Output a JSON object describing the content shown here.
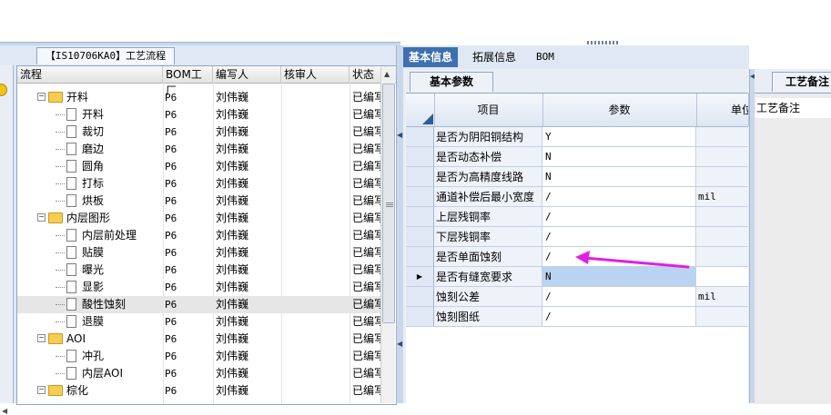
{
  "left_panel": {
    "process_tab": "【IS10706KA0】工艺流程",
    "columns": [
      "流程",
      "BOM工厂",
      "编写人",
      "核审人",
      "状态"
    ],
    "rows": [
      {
        "name": "开料",
        "type": "folder",
        "bom": "P6",
        "writer": "刘伟巍",
        "reviewer": "",
        "status": "已编写"
      },
      {
        "name": "开料",
        "type": "doc",
        "bom": "P6",
        "writer": "刘伟巍",
        "reviewer": "",
        "status": "已编写"
      },
      {
        "name": "裁切",
        "type": "doc",
        "bom": "P6",
        "writer": "刘伟巍",
        "reviewer": "",
        "status": "已编写"
      },
      {
        "name": "磨边",
        "type": "doc",
        "bom": "P6",
        "writer": "刘伟巍",
        "reviewer": "",
        "status": "已编写"
      },
      {
        "name": "圆角",
        "type": "doc",
        "bom": "P6",
        "writer": "刘伟巍",
        "reviewer": "",
        "status": "已编写"
      },
      {
        "name": "打标",
        "type": "doc",
        "bom": "P6",
        "writer": "刘伟巍",
        "reviewer": "",
        "status": "已编写"
      },
      {
        "name": "烘板",
        "type": "doc",
        "bom": "P6",
        "writer": "刘伟巍",
        "reviewer": "",
        "status": "已编写"
      },
      {
        "name": "内层图形",
        "type": "folder",
        "bom": "P6",
        "writer": "刘伟巍",
        "reviewer": "",
        "status": "已编写"
      },
      {
        "name": "内层前处理",
        "type": "doc",
        "bom": "P6",
        "writer": "刘伟巍",
        "reviewer": "",
        "status": "已编写"
      },
      {
        "name": "贴膜",
        "type": "doc",
        "bom": "P6",
        "writer": "刘伟巍",
        "reviewer": "",
        "status": "已编写"
      },
      {
        "name": "曝光",
        "type": "doc",
        "bom": "P6",
        "writer": "刘伟巍",
        "reviewer": "",
        "status": "已编写"
      },
      {
        "name": "显影",
        "type": "doc",
        "bom": "P6",
        "writer": "刘伟巍",
        "reviewer": "",
        "status": "已编写"
      },
      {
        "name": "酸性蚀刻",
        "type": "doc",
        "bom": "P6",
        "writer": "刘伟巍",
        "reviewer": "",
        "status": "已编写",
        "selected": true
      },
      {
        "name": "退膜",
        "type": "doc",
        "bom": "P6",
        "writer": "刘伟巍",
        "reviewer": "",
        "status": "已编写"
      },
      {
        "name": "AOI",
        "type": "folder",
        "bom": "P6",
        "writer": "刘伟巍",
        "reviewer": "",
        "status": "已编写"
      },
      {
        "name": "冲孔",
        "type": "doc",
        "bom": "P6",
        "writer": "刘伟巍",
        "reviewer": "",
        "status": "已编写"
      },
      {
        "name": "内层AOI",
        "type": "doc",
        "bom": "P6",
        "writer": "刘伟巍",
        "reviewer": "",
        "status": "已编写"
      },
      {
        "name": "棕化",
        "type": "folder",
        "bom": "P6",
        "writer": "刘伟巍",
        "reviewer": "",
        "status": "已编写"
      }
    ]
  },
  "middle_panel": {
    "tabs": [
      "基本信息",
      "拓展信息",
      "BOM"
    ],
    "active_tab": "基本信息",
    "subtab": "基本参数",
    "columns": {
      "item": "项目",
      "param": "参数",
      "unit": "单位"
    },
    "rows": [
      {
        "item": "是否为阴阳铜结构",
        "value": "Y",
        "unit": ""
      },
      {
        "item": "是否动态补偿",
        "value": "N",
        "unit": ""
      },
      {
        "item": "是否为高精度线路",
        "value": "N",
        "unit": ""
      },
      {
        "item": "通道补偿后最小宽度",
        "value": "/",
        "unit": "mil"
      },
      {
        "item": "上层残铜率",
        "value": "/",
        "unit": ""
      },
      {
        "item": "下层残铜率",
        "value": "/",
        "unit": ""
      },
      {
        "item": "是否单面蚀刻",
        "value": "/",
        "unit": ""
      },
      {
        "item": "是否有缝宽要求",
        "value": "N",
        "unit": "",
        "current": true
      },
      {
        "item": "蚀刻公差",
        "value": "/",
        "unit": "mil"
      },
      {
        "item": "蚀刻图纸",
        "value": "/",
        "unit": ""
      }
    ]
  },
  "right_panel": {
    "tab": "工艺备注",
    "field_label": "工艺备注"
  },
  "annotation": {
    "color": "#e21ee6"
  }
}
